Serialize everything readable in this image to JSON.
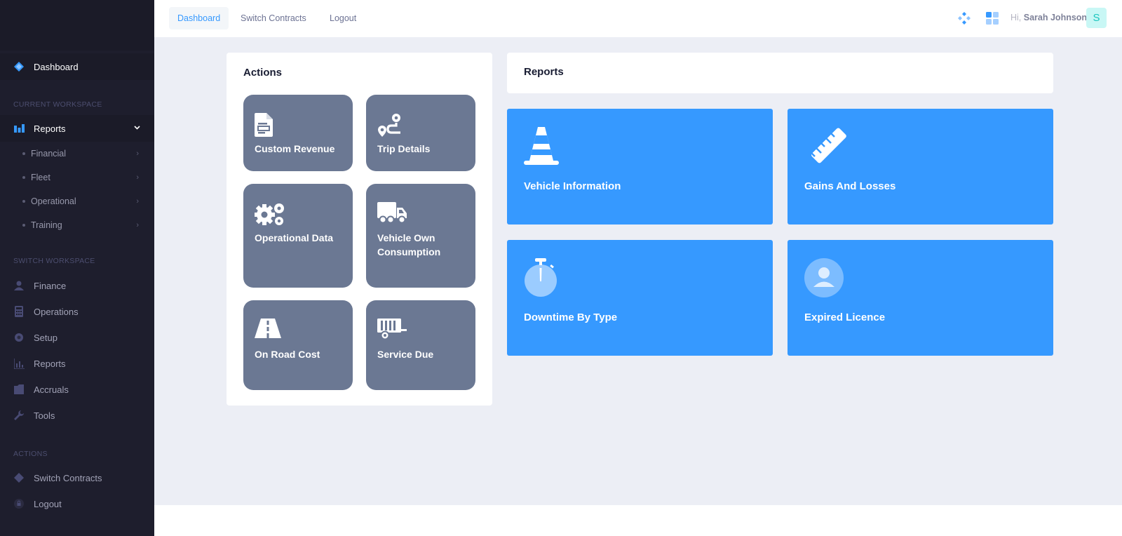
{
  "sidebar": {
    "dashboard": "Dashboard",
    "section_current": "Current Workspace",
    "reports": "Reports",
    "sub": [
      "Financial",
      "Fleet",
      "Operational",
      "Training"
    ],
    "section_switch": "Switch Workspace",
    "workspaces": [
      "Finance",
      "Operations",
      "Setup",
      "Reports",
      "Accruals",
      "Tools"
    ],
    "section_actions": "Actions",
    "actions": [
      "Switch Contracts",
      "Logout"
    ]
  },
  "header": {
    "nav": [
      "Dashboard",
      "Switch Contracts",
      "Logout"
    ],
    "greeting": "Hi,",
    "user_name": "Sarah Johnson",
    "avatar_letter": "S"
  },
  "actions_card": {
    "title": "Actions",
    "tiles": [
      "Custom Revenue",
      "Trip Details",
      "Operational Data",
      "Vehicle Own Consumption",
      "On Road Cost",
      "Service Due"
    ]
  },
  "reports_card": {
    "title": "Reports",
    "tiles": [
      "Vehicle Information",
      "Gains And Losses",
      "Downtime By Type",
      "Expired Licence"
    ]
  },
  "colors": {
    "sidebar_bg": "#1e1e2d",
    "accent": "#3699ff",
    "action_tile": "#6b7893",
    "page_bg": "#eceef5"
  },
  "icons": {
    "custom_revenue": "document-icon",
    "trip_details": "route-icon",
    "operational_data": "gears-icon",
    "vehicle_own_consumption": "truck-icon",
    "on_road_cost": "road-icon",
    "service_due": "trailer-icon",
    "vehicle_information": "traffic-cone-icon",
    "gains_and_losses": "ruler-icon",
    "downtime_by_type": "stopwatch-icon",
    "expired_licence": "user-icon"
  }
}
